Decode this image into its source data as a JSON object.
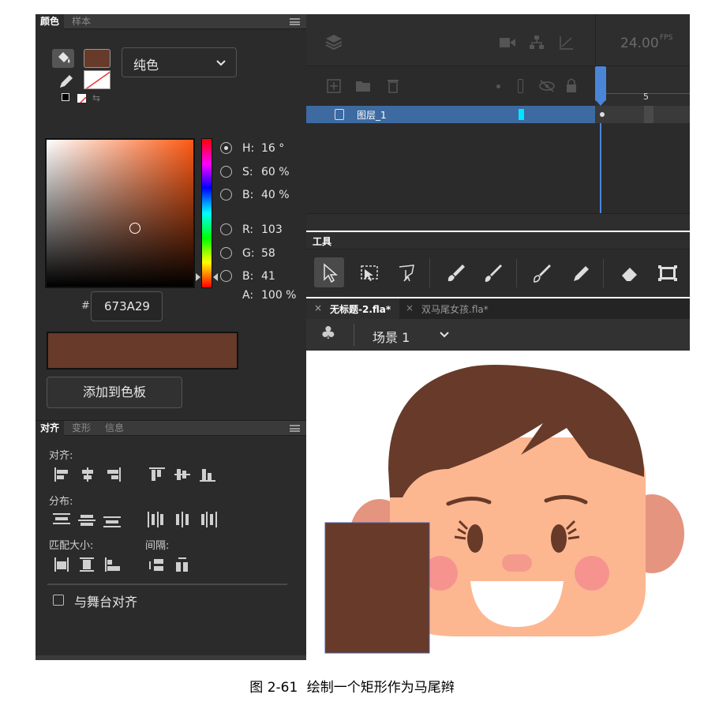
{
  "color_panel": {
    "tabs": [
      "颜色",
      "样本"
    ],
    "fill_type": "纯色",
    "hsb": [
      {
        "label": "H:",
        "value": "16 °"
      },
      {
        "label": "S:",
        "value": "60 %"
      },
      {
        "label": "B:",
        "value": "40 %"
      }
    ],
    "rgb": [
      {
        "label": "R:",
        "value": "103"
      },
      {
        "label": "G:",
        "value": "58"
      },
      {
        "label": "B:",
        "value": "41"
      }
    ],
    "alpha_label": "A:",
    "alpha_value": "100 %",
    "hash_label": "#",
    "hex_value": "673A29",
    "add_swatch_label": "添加到色板",
    "current_color": "#673A29",
    "stroke_color": "none"
  },
  "align_panel": {
    "tabs": [
      "对齐",
      "变形",
      "信息"
    ],
    "align_label": "对齐:",
    "distribute_label": "分布:",
    "match_size_label": "匹配大小:",
    "spacing_label": "间隔:",
    "stage_align_label": "与舞台对齐"
  },
  "timeline": {
    "fps": "24.00",
    "fps_unit": "FPS",
    "frame_marker": "5",
    "layer_name": "图层_1"
  },
  "tools": {
    "title": "工具"
  },
  "documents": {
    "tabs": [
      {
        "close": "×",
        "name": "无标题-2.fla*"
      },
      {
        "close": "×",
        "name": "双马尾女孩.fla*"
      }
    ]
  },
  "scene": {
    "name": "场景 1"
  },
  "caption": {
    "label": "图 2-61",
    "text": "绘制一个矩形作为马尾辫"
  },
  "colors": {
    "hair": "#673A29",
    "skin": "#FCB791",
    "ear": "#E59480",
    "accent_selection": "#3D6AA0"
  }
}
